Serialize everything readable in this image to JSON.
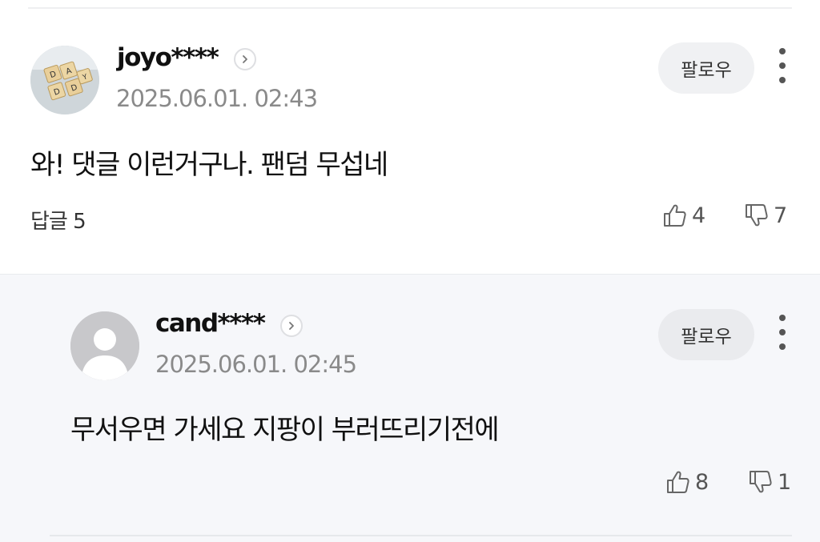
{
  "comments": [
    {
      "username": "joyo****",
      "timestamp": "2025.06.01. 02:43",
      "follow_label": "팔로우",
      "text": "와! 댓글 이런거구나. 팬덤 무섭네",
      "replies_label": "답글 5",
      "likes": "4",
      "dislikes": "7",
      "avatar_tiles": [
        "D",
        "A",
        "D",
        "D",
        "Y"
      ]
    },
    {
      "username": "cand****",
      "timestamp": "2025.06.01. 02:45",
      "follow_label": "팔로우",
      "text": "무서우면 가세요 지팡이 부러뜨리기전에",
      "likes": "8",
      "dislikes": "1"
    }
  ],
  "icons": {
    "profile_link": "chevron-right-icon",
    "more": "more-vertical-icon",
    "like": "thumbs-up-icon",
    "dislike": "thumbs-down-icon"
  }
}
